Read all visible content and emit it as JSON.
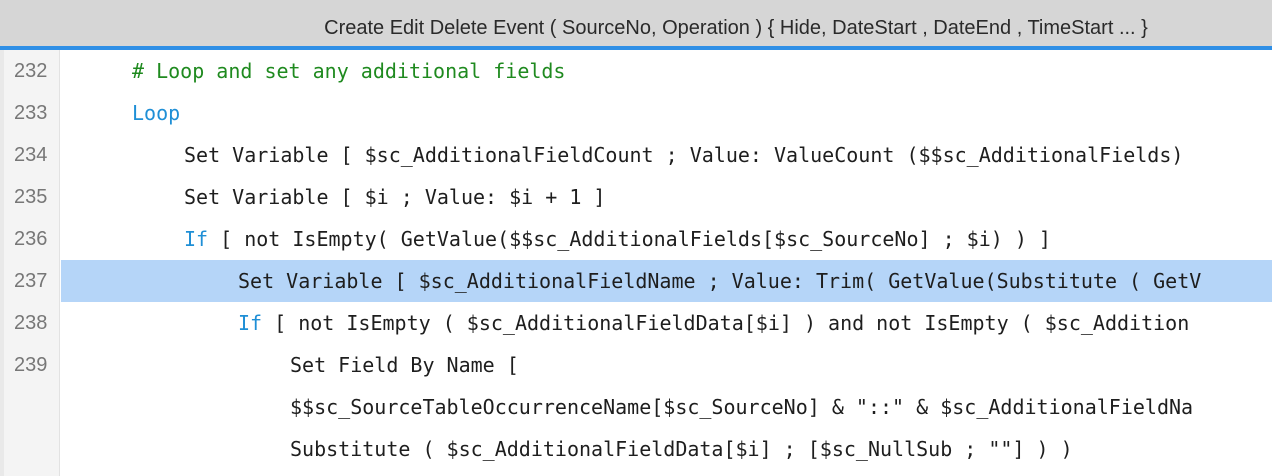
{
  "tab": {
    "title": "Create Edit Delete Event ( SourceNo, Operation ) { Hide, DateStart , DateEnd , TimeStart ... }"
  },
  "colors": {
    "accent": "#2f8fe6",
    "selection": "#b5d5f8",
    "keyword": "#1f8fd6",
    "comment": "#1f8a1f"
  },
  "lines": [
    {
      "num": "232",
      "comment": "# Loop and set any additional fields"
    },
    {
      "num": "233",
      "keyword": "Loop"
    },
    {
      "num": "234",
      "text": "Set Variable [ $sc_AdditionalFieldCount ; Value: ValueCount ($$sc_AdditionalFields)"
    },
    {
      "num": "235",
      "text": "Set Variable [ $i ; Value: $i + 1 ]"
    },
    {
      "num": "236",
      "keyword": "If",
      "text": " [ not IsEmpty( GetValue($$sc_AdditionalFields[$sc_SourceNo] ; $i) ) ]"
    },
    {
      "num": "237",
      "text": "Set Variable [ $sc_AdditionalFieldName ; Value: Trim( GetValue(Substitute ( GetV",
      "selected": true
    },
    {
      "num": "238",
      "keyword": "If",
      "text": " [ not IsEmpty ( $sc_AdditionalFieldData[$i] ) and not IsEmpty ( $sc_Addition"
    },
    {
      "num": "239",
      "text": "Set Field By Name ["
    },
    {
      "num": "",
      "text": "$$sc_SourceTableOccurrenceName[$sc_SourceNo] & \"::\" & $sc_AdditionalFieldNa"
    },
    {
      "num": "",
      "text": "Substitute ( $sc_AdditionalFieldData[$i] ; [$sc_NullSub ; \"\"] ) )"
    }
  ]
}
